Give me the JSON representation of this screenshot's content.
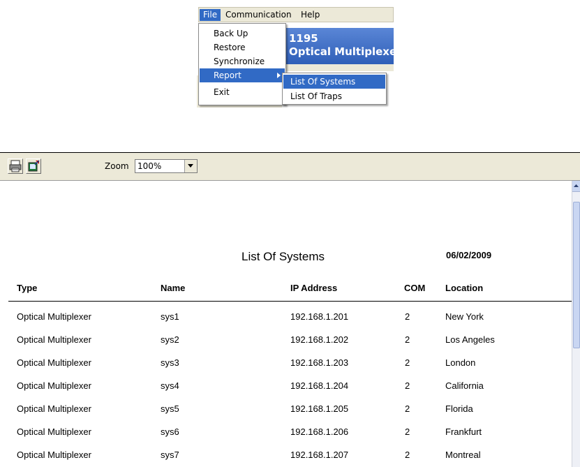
{
  "menubar": {
    "file": "File",
    "communication": "Communication",
    "help": "Help"
  },
  "background_window": {
    "line1": "1195",
    "line2": "Optical Multiplexer"
  },
  "file_menu": {
    "items": [
      "Back Up",
      "Restore",
      "Synchronize",
      "Report",
      "Exit"
    ]
  },
  "report_submenu": {
    "items": [
      "List Of Systems",
      "List Of Traps"
    ]
  },
  "toolbar": {
    "zoom_label": "Zoom",
    "zoom_value": "100%"
  },
  "report": {
    "title": "List Of Systems",
    "date": "06/02/2009",
    "columns": [
      "Type",
      "Name",
      "IP Address",
      "COM",
      "Location"
    ],
    "rows": [
      [
        "Optical Multiplexer",
        "sys1",
        "192.168.1.201",
        "2",
        "New York"
      ],
      [
        "Optical Multiplexer",
        "sys2",
        "192.168.1.202",
        "2",
        "Los Angeles"
      ],
      [
        "Optical Multiplexer",
        "sys3",
        "192.168.1.203",
        "2",
        "London"
      ],
      [
        "Optical Multiplexer",
        "sys4",
        "192.168.1.204",
        "2",
        "California"
      ],
      [
        "Optical Multiplexer",
        "sys5",
        "192.168.1.205",
        "2",
        "Florida"
      ],
      [
        "Optical Multiplexer",
        "sys6",
        "192.168.1.206",
        "2",
        "Frankfurt"
      ],
      [
        "Optical Multiplexer",
        "sys7",
        "192.168.1.207",
        "2",
        "Montreal"
      ]
    ]
  }
}
